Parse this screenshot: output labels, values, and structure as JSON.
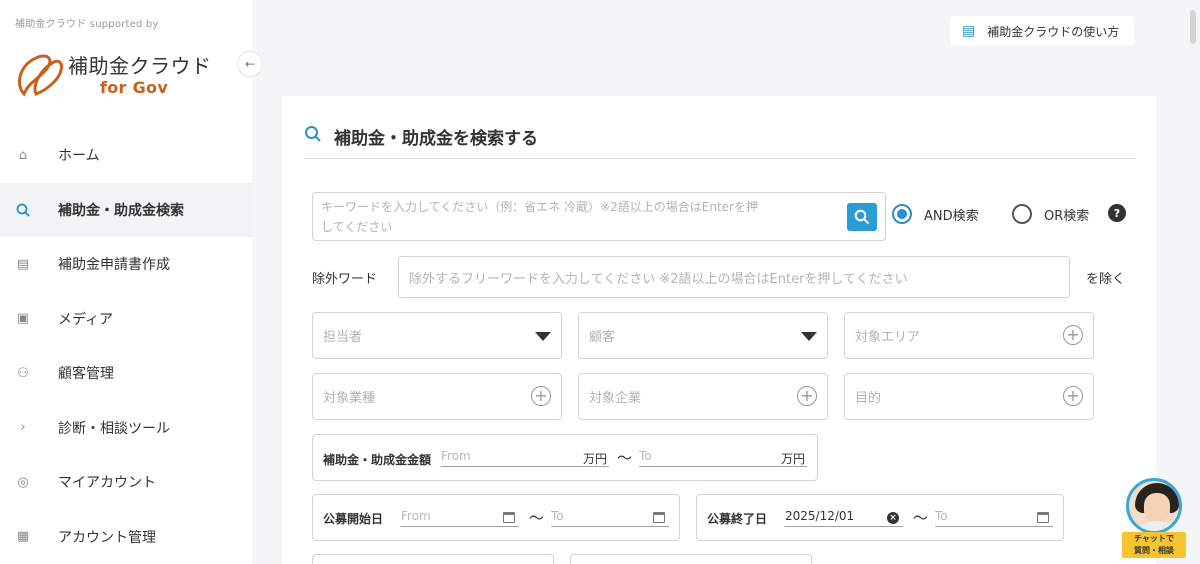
{
  "sidebar": {
    "supported_by": "補助金クラウド supported by",
    "logo_name": "補助金クラウド",
    "logo_sub": "for Gov",
    "collapse_icon": "arrow-left-icon",
    "items": [
      {
        "label": "ホーム",
        "icon": "home-icon",
        "glyph": "⌂",
        "active": false
      },
      {
        "label": "補助金・助成金検索",
        "icon": "search-icon",
        "glyph": "Q",
        "active": true
      },
      {
        "label": "補助金申請書作成",
        "icon": "document-icon",
        "glyph": "▤",
        "active": false
      },
      {
        "label": "メディア",
        "icon": "media-icon",
        "glyph": "▣",
        "active": false
      },
      {
        "label": "顧客管理",
        "icon": "users-icon",
        "glyph": "⚇",
        "active": false
      },
      {
        "label": "診断・相談ツール",
        "icon": "chevron-right-icon",
        "glyph": "›",
        "active": false
      },
      {
        "label": "マイアカウント",
        "icon": "account-icon",
        "glyph": "◎",
        "active": false
      },
      {
        "label": "アカウント管理",
        "icon": "grid-icon",
        "glyph": "▦",
        "active": false
      }
    ]
  },
  "header": {
    "help_label": "補助金クラウドの使い方"
  },
  "search": {
    "title": "補助金・助成金を検索する",
    "keyword_placeholder_line1": "キーワードを入力してください（例：省エネ 冷蔵）※2語以上の場合はEnterを押",
    "keyword_placeholder_line2": "してください",
    "and_label": "AND検索",
    "or_label": "OR検索",
    "mode_selected": "AND",
    "help_badge": "?",
    "exclude_label": "除外ワード",
    "exclude_placeholder": "除外するフリーワードを入力してください ※2語以上の場合はEnterを押してください",
    "exclude_button": "を除く",
    "filters": {
      "tantousha": "担当者",
      "kokyaku": "顧客",
      "area": "対象エリア",
      "gyoushu": "対象業種",
      "kigyou": "対象企業",
      "mokuteki": "目的"
    },
    "amount": {
      "label": "補助金・助成金金額",
      "from_placeholder": "From",
      "to_placeholder": "To",
      "unit": "万円",
      "tilde": "〜"
    },
    "start_date": {
      "label": "公募開始日",
      "from_placeholder": "From",
      "to_placeholder": "To",
      "tilde": "〜"
    },
    "end_date": {
      "label": "公募終了日",
      "from_value": "2025/12/01",
      "to_placeholder": "To",
      "tilde": "〜"
    }
  },
  "chat": {
    "tag_line1": "チャットで",
    "tag_line2": "質問・相談"
  },
  "colors": {
    "accent": "#2b8fc6",
    "brand_orange": "#c8611d",
    "chat_tag": "#f6c42e"
  }
}
